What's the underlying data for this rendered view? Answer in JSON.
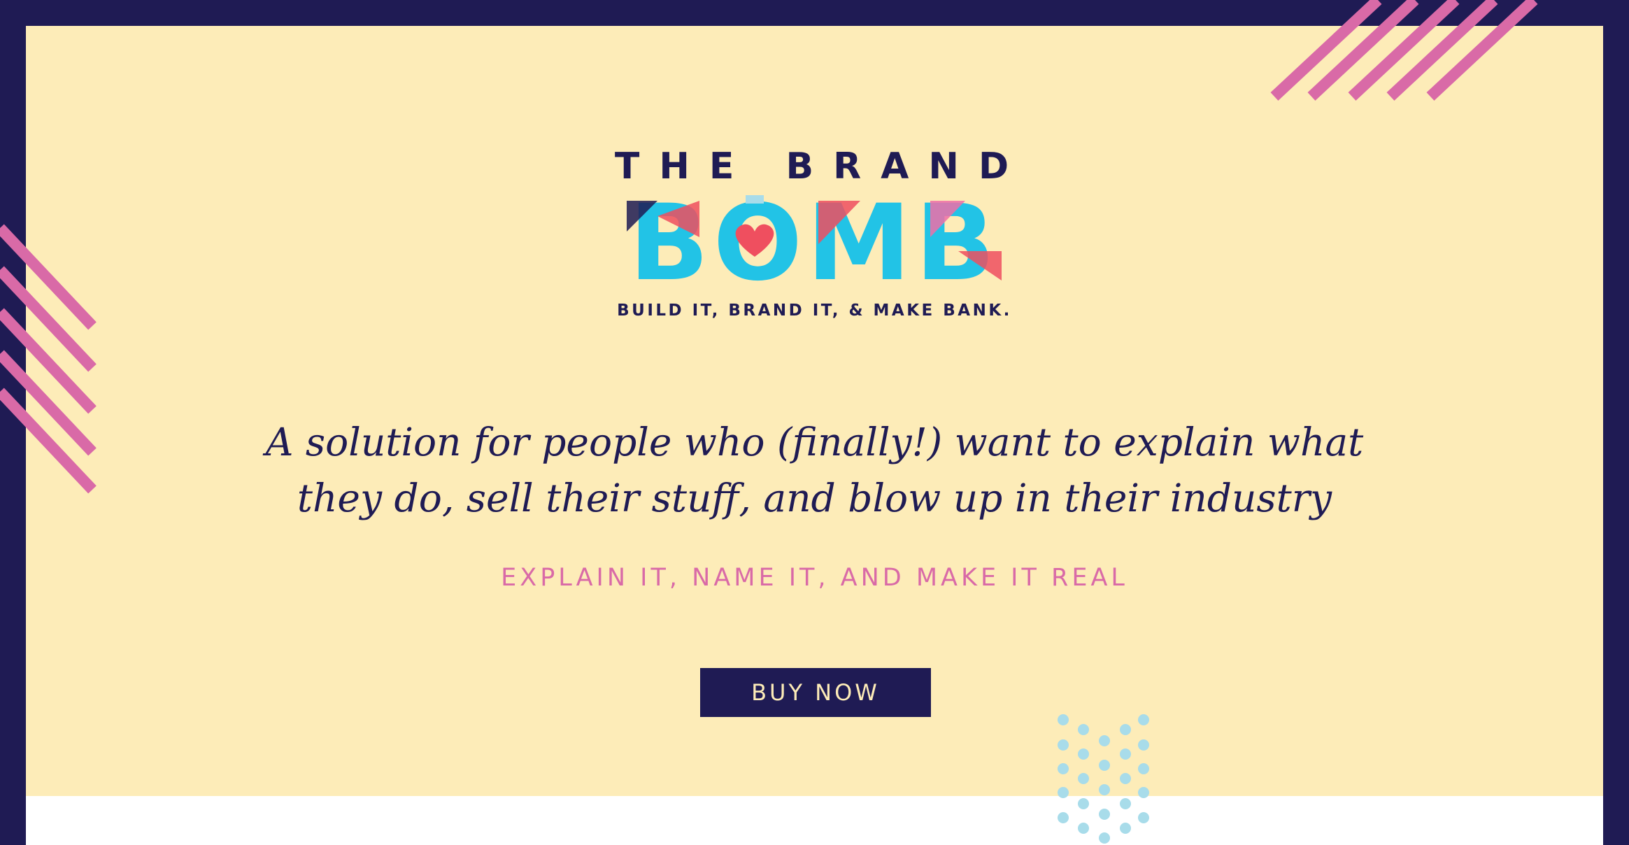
{
  "brand": {
    "top_line": "THE BRAND",
    "logo_word": "BOMB",
    "tagline": "BUILD IT, BRAND IT, & MAKE BANK."
  },
  "hero": {
    "headline_line1": "A solution for people who (finally!) want to explain what",
    "headline_line2": "they do, sell their stuff, and blow up in their industry",
    "subhead": "EXPLAIN IT, NAME IT, AND MAKE IT REAL"
  },
  "cta": {
    "buy_label": "BUY NOW"
  },
  "colors": {
    "navy": "#1f1b54",
    "cream": "#fdecb8",
    "pink": "#d96aa7",
    "coral": "#ef4f5f",
    "cyan": "#22c3e6",
    "light_blue": "#a8dcea"
  },
  "icons": {
    "top_right_deco": "diagonal-stripes-icon",
    "left_deco": "diagonal-stripes-icon",
    "dots_deco": "dot-pattern-icon",
    "heart": "heart-icon"
  }
}
